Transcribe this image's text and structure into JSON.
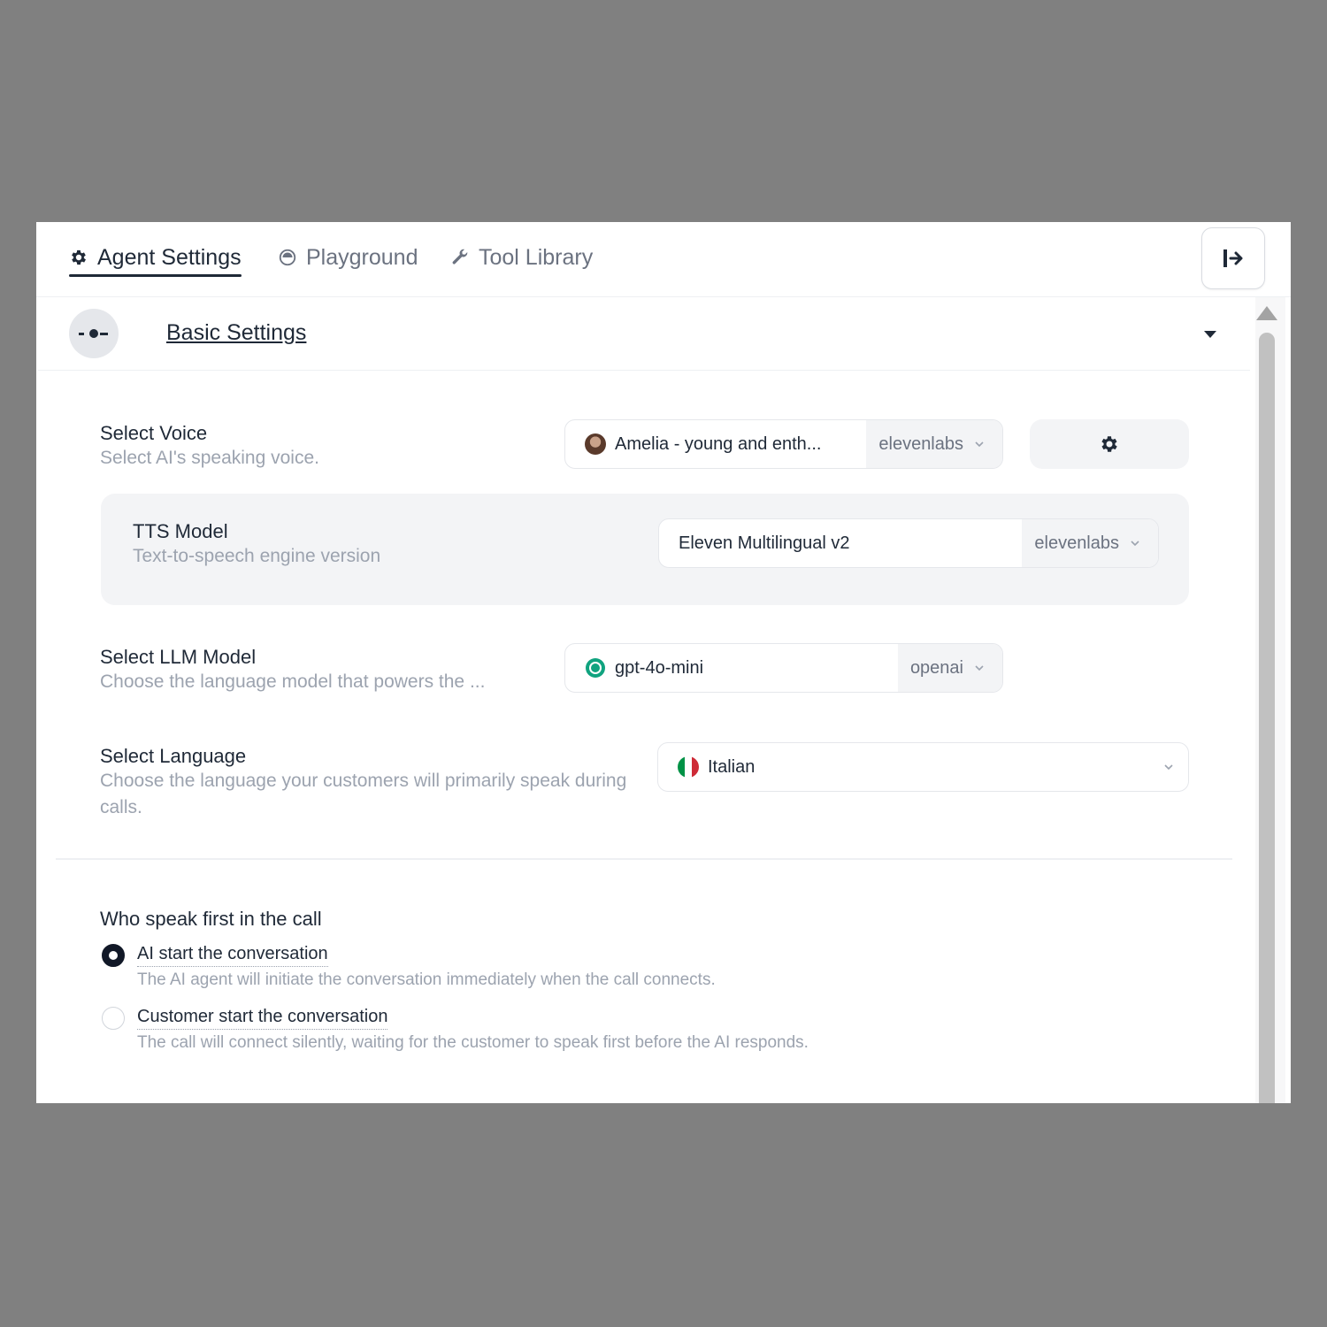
{
  "tabs": [
    {
      "label": "Agent Settings",
      "icon": "gear-icon",
      "active": true
    },
    {
      "label": "Playground",
      "icon": "playground-icon",
      "active": false
    },
    {
      "label": "Tool Library",
      "icon": "wrench-icon",
      "active": false
    }
  ],
  "section": {
    "title": "Basic Settings",
    "icon": "slider-dots-icon"
  },
  "voice": {
    "label": "Select Voice",
    "description": "Select AI's speaking voice.",
    "value": "Amelia - young and enth...",
    "provider": "elevenlabs"
  },
  "tts": {
    "label": "TTS Model",
    "description": "Text-to-speech engine version",
    "value": "Eleven Multilingual v2",
    "provider": "elevenlabs"
  },
  "llm": {
    "label": "Select LLM Model",
    "description": "Choose the language model that powers the ...",
    "value": "gpt-4o-mini",
    "provider": "openai"
  },
  "language": {
    "label": "Select Language",
    "description": "Choose the language your customers will primarily speak during calls.",
    "value": "Italian"
  },
  "first_speaker": {
    "label": "Who speak first in the call",
    "options": [
      {
        "label": "AI start the conversation",
        "description": "The AI agent will initiate the conversation immediately when the call connects.",
        "selected": true
      },
      {
        "label": "Customer start the conversation",
        "description": "The call will connect silently, waiting for the customer to speak first before the AI responds.",
        "selected": false
      }
    ]
  },
  "colors": {
    "text_primary": "#1f2937",
    "text_muted": "#9ca3af",
    "surface_muted": "#f3f4f6",
    "backdrop": "#808080"
  }
}
